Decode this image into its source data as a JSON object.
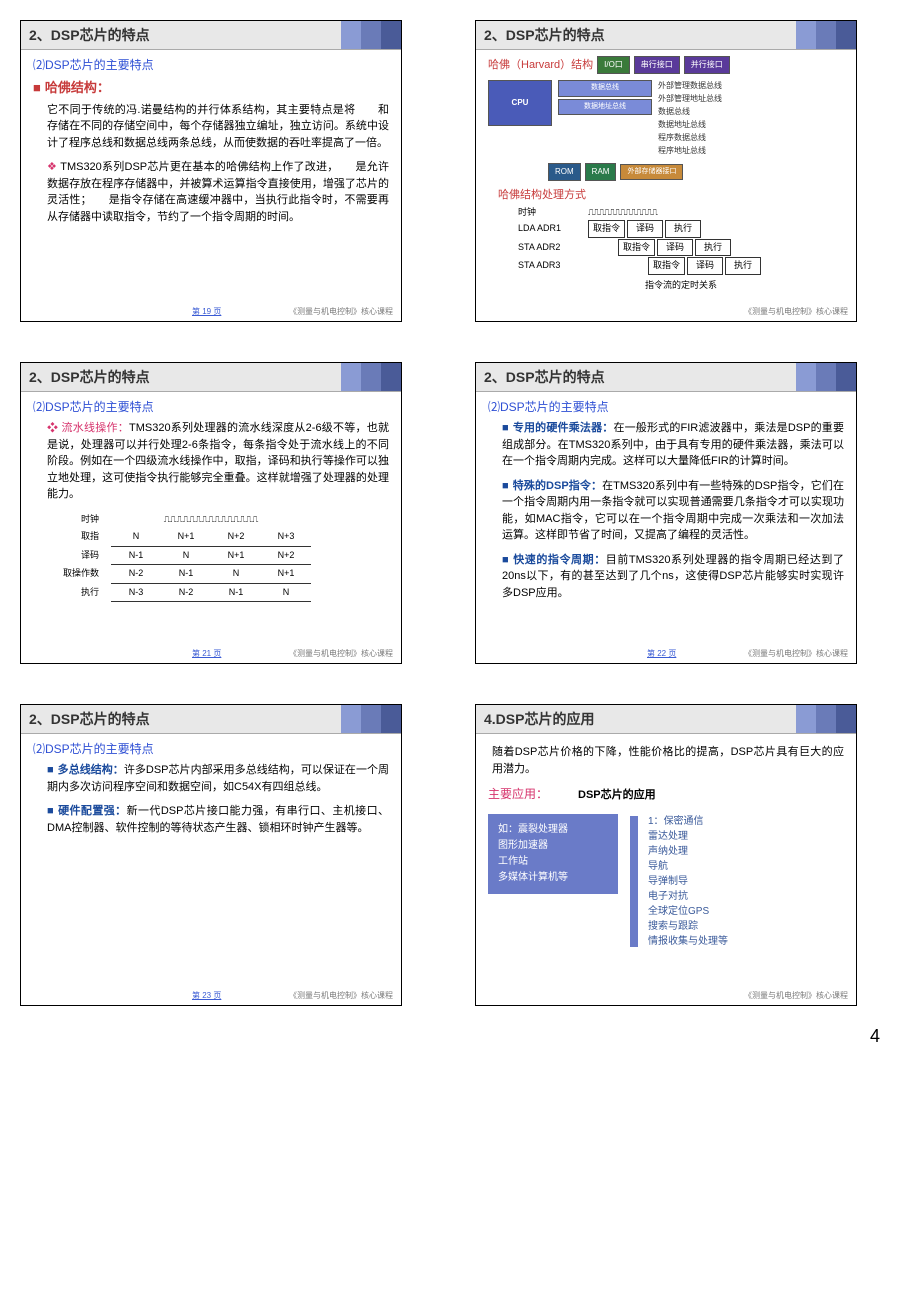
{
  "footer_text": "《测量与机电控制》核心课程",
  "page_number": "4",
  "slides": {
    "s19": {
      "title": "2、DSP芯片的特点",
      "subtitle": "⑵DSP芯片的主要特点",
      "section": "哈佛结构：",
      "p1": "它不同于传统的冯.诺曼结构的并行体系结构，其主要特点是将　　和　　存储在不同的存储空间中，每个存储器独立编址，独立访问。系统中设计了程序总线和数据总线两条总线，从而使数据的吞吐率提高了一倍。",
      "p2": "TMS320系列DSP芯片更在基本的哈佛结构上作了改进，　　是允许数据存放在程序存储器中，并被算术运算指令直接使用，增强了芯片的灵活性；　　是指令存储在高速缓冲器中，当执行此指令时，不需要再从存储器中读取指令，节约了一个指令周期的时间。",
      "pgnum": "第 19 页"
    },
    "s20": {
      "title": "2、DSP芯片的特点",
      "harvard_label": "哈佛（Harvard）结构",
      "io": "I/O口",
      "serial": "串行接口",
      "parallel": "并行接口",
      "cpu": "CPU",
      "rom": "ROM",
      "ram": "RAM",
      "ext_mem": "外部存储器接口",
      "bus_labels": [
        "外部管理数据总线",
        "外部管理地址总线",
        "数据总线",
        "数据地址总线",
        "程序数据总线",
        "程序地址总线"
      ],
      "sub2": "哈佛结构处理方式",
      "clock": "时钟",
      "instr1": "LDA  ADR1",
      "instr2": "STA  ADR2",
      "instr3": "STA  ADR3",
      "stages": [
        "取指令",
        "译码",
        "执行"
      ],
      "caption": "指令流的定时关系"
    },
    "s21": {
      "title": "2、DSP芯片的特点",
      "subtitle": "⑵DSP芯片的主要特点",
      "p1_lead": "流水线操作：",
      "p1": "TMS320系列处理器的流水线深度从2-6级不等，也就是说，处理器可以并行处理2-6条指令，每条指令处于流水线上的不同阶段。例如在一个四级流水线操作中，取指，译码和执行等操作可以独立地处理，这可使指令执行能够完全重叠。这样就增强了处理器的处理能力。",
      "pipe_rows": [
        "时钟",
        "取指",
        "译码",
        "取操作数",
        "执行"
      ],
      "pipe_data": [
        [
          "N",
          "N+1",
          "N+2",
          "N+3"
        ],
        [
          "N-1",
          "N",
          "N+1",
          "N+2"
        ],
        [
          "N-2",
          "N-1",
          "N",
          "N+1"
        ],
        [
          "N-3",
          "N-2",
          "N-1",
          "N"
        ]
      ],
      "pgnum": "第 21 页"
    },
    "s22": {
      "title": "2、DSP芯片的特点",
      "subtitle": "⑵DSP芯片的主要特点",
      "b1_lead": "专用的硬件乘法器：",
      "b1": "在一般形式的FIR滤波器中，乘法是DSP的重要组成部分。在TMS320系列中，由于具有专用的硬件乘法器，乘法可以在一个指令周期内完成。这样可以大量降低FIR的计算时间。",
      "b2_lead": "特殊的DSP指令：",
      "b2": "在TMS320系列中有一些特殊的DSP指令，它们在一个指令周期内用一条指令就可以实现普通需要几条指令才可以实现功能，如MAC指令，它可以在一个指令周期中完成一次乘法和一次加法运算。这样即节省了时间，又提高了编程的灵活性。",
      "b3_lead": "快速的指令周期：",
      "b3": "目前TMS320系列处理器的指令周期已经达到了20ns以下，有的甚至达到了几个ns，这使得DSP芯片能够实时实现许多DSP应用。",
      "pgnum": "第 22 页"
    },
    "s23": {
      "title": "2、DSP芯片的特点",
      "subtitle": "⑵DSP芯片的主要特点",
      "b1_lead": "多总线结构：",
      "b1": "许多DSP芯片内部采用多总线结构，可以保证在一个周期内多次访问程序空间和数据空间，如C54X有四组总线。",
      "b2_lead": "硬件配置强：",
      "b2": "新一代DSP芯片接口能力强，有串行口、主机接口、DMA控制器、软件控制的等待状态产生器、锁相环时钟产生器等。",
      "pgnum": "第 23 页"
    },
    "s24": {
      "title": "4.DSP芯片的应用",
      "p1": "随着DSP芯片价格的下降，性能价格比的提高，DSP芯片具有巨大的应用潜力。",
      "main_label": "主要应用：",
      "diagram_title": "DSP芯片的应用",
      "left_head": "如：震裂处理器",
      "left_items": [
        "图形加速器",
        "工作站",
        "多媒体计算机等"
      ],
      "right_head": "1：",
      "right_items": [
        "保密通信",
        "雷达处理",
        "声纳处理",
        "导航",
        "导弹制导",
        "电子对抗",
        "全球定位GPS",
        "搜索与跟踪",
        "情报收集与处理等"
      ]
    }
  }
}
